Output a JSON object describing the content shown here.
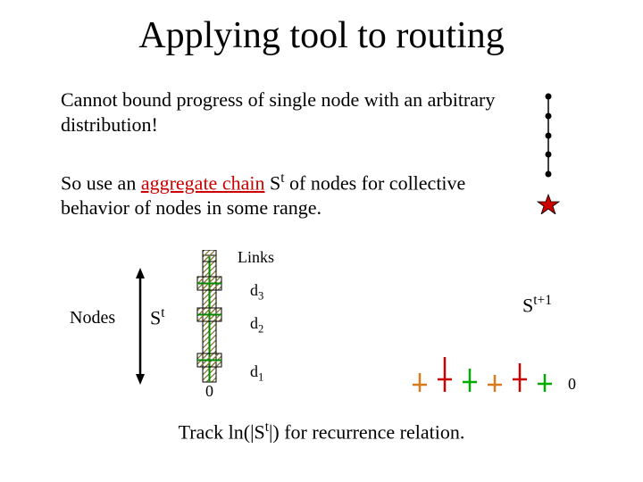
{
  "title": "Applying tool to routing",
  "para1": "Cannot bound progress of single node with an arbitrary distribution!",
  "para2_pre": "So use an ",
  "para2_agg": "aggregate chain",
  "para2_post": " S",
  "para2_post2": " of nodes for collective behavior of nodes in some range.",
  "t": "t",
  "nodes": "Nodes",
  "links": "Links",
  "st": "S",
  "st1_suffix": "t+1",
  "d3": "d",
  "d2": "d",
  "d1": "d",
  "n3": "3",
  "n2": "2",
  "n1": "1",
  "zero": "0",
  "bottom_pre": "Track ln(|S",
  "bottom_post": "|) for recurrence relation."
}
